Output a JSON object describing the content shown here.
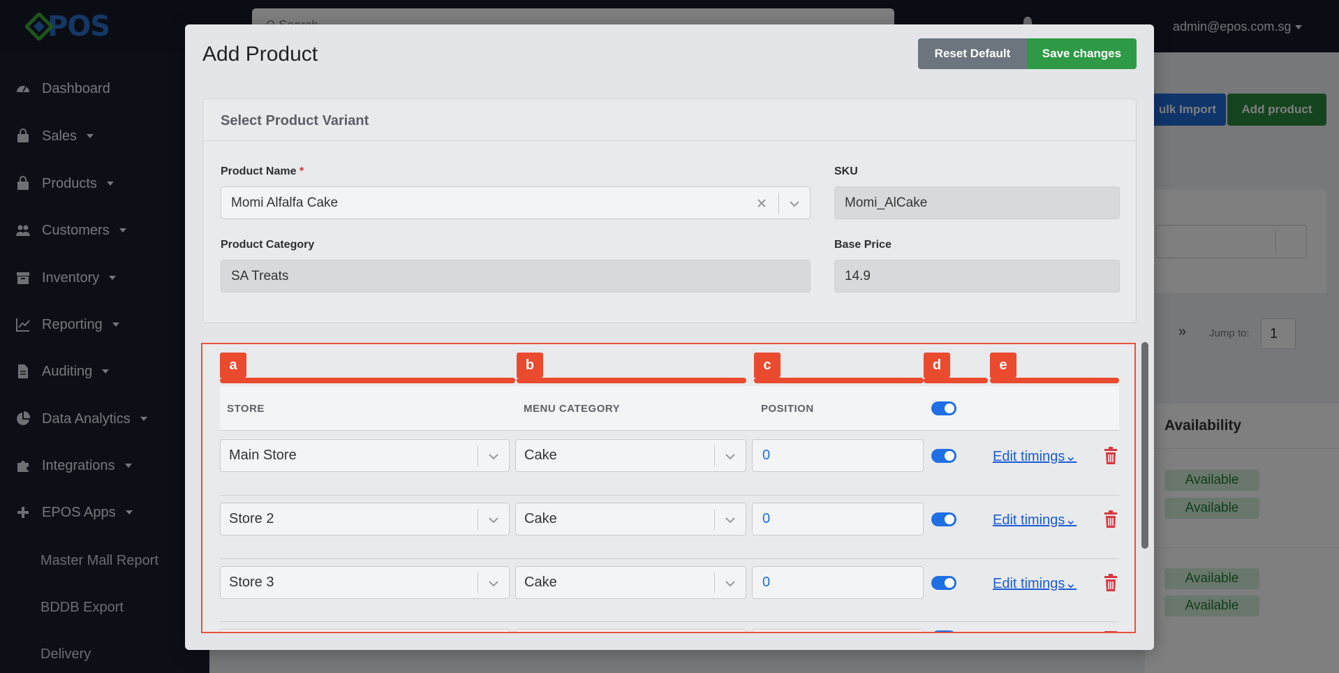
{
  "app": {
    "logo_text": "POS",
    "search_placeholder": "Search",
    "user_email": "admin@epos.com.sg"
  },
  "sidebar": {
    "items": [
      {
        "label": "Dashboard",
        "icon": "gauge-icon"
      },
      {
        "label": "Sales",
        "icon": "bag-icon"
      },
      {
        "label": "Products",
        "icon": "bag-icon"
      },
      {
        "label": "Customers",
        "icon": "users-icon"
      },
      {
        "label": "Inventory",
        "icon": "archive-icon"
      },
      {
        "label": "Reporting",
        "icon": "line-chart-icon"
      },
      {
        "label": "Auditing",
        "icon": "file-icon"
      },
      {
        "label": "Data Analytics",
        "icon": "pie-chart-icon"
      },
      {
        "label": "Integrations",
        "icon": "puzzle-icon"
      },
      {
        "label": "EPOS Apps",
        "icon": "plus-icon"
      }
    ],
    "sub_items": [
      "Master Mall Report",
      "BDDB Export",
      "Delivery"
    ]
  },
  "background_page": {
    "bulk_import_label": "ulk Import",
    "add_product_label": "Add product",
    "pager_next": "»",
    "jump_to_label": "Jump to:",
    "jump_to_value": "1",
    "availability_header": "Availability",
    "availability_values": [
      "Available",
      "Available",
      "Available",
      "Available"
    ]
  },
  "modal": {
    "title": "Add Product",
    "reset_label": "Reset Default",
    "save_label": "Save changes",
    "variant_card": {
      "title": "Select Product Variant",
      "product_name_label": "Product Name",
      "required_mark": "*",
      "product_name_value": "Momi Alfalfa Cake",
      "sku_label": "SKU",
      "sku_value": "Momi_AlCake",
      "category_label": "Product Category",
      "category_value": "SA Treats",
      "base_price_label": "Base Price",
      "base_price_value": "14.9"
    },
    "markers": [
      "a",
      "b",
      "c",
      "d",
      "e"
    ],
    "table": {
      "headers": {
        "store": "STORE",
        "menu_category": "MENU CATEGORY",
        "position": "POSITION"
      },
      "edit_timings_label": "Edit timings",
      "rows": [
        {
          "store": "Main Store",
          "menu_category": "Cake",
          "position": "0",
          "enabled": true
        },
        {
          "store": "Store 2",
          "menu_category": "Cake",
          "position": "0",
          "enabled": true
        },
        {
          "store": "Store 3",
          "menu_category": "Cake",
          "position": "0",
          "enabled": true
        }
      ]
    }
  },
  "colors": {
    "accent_blue": "#1f6fe5",
    "save_green": "#2e9a45",
    "reset_gray": "#6c757d",
    "highlight_red": "#ea4a2e",
    "danger_red": "#d9363e"
  }
}
